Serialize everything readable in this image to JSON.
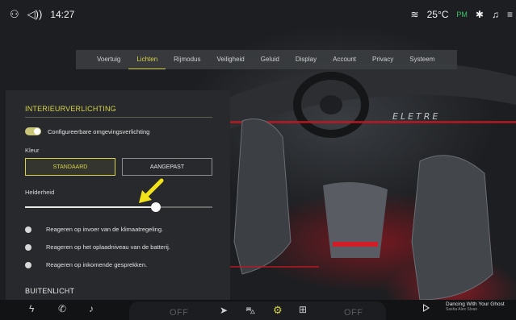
{
  "status": {
    "time": "14:27",
    "temperature": "25°C",
    "eco_label": "PM",
    "icons": [
      "user-icon",
      "volume-icon",
      "wifi-icon",
      "bluetooth-icon",
      "bell-icon",
      "settings-icon"
    ]
  },
  "nav": {
    "tabs": [
      {
        "label": "Voertuig"
      },
      {
        "label": "Lichten"
      },
      {
        "label": "Rijmodus"
      },
      {
        "label": "Veiligheid"
      },
      {
        "label": "Geluid"
      },
      {
        "label": "Display"
      },
      {
        "label": "Account"
      },
      {
        "label": "Privacy"
      },
      {
        "label": "Systeem"
      }
    ],
    "active": "Lichten"
  },
  "panel": {
    "title": "INTERIEURVERLICHTING",
    "toggle_label": "Configureerbare omgevingsverlichting",
    "toggle_on": true,
    "kleur_label": "Kleur",
    "buttons": {
      "standaard": "STANDAARD",
      "aangepast": "AANGEPAST"
    },
    "selected_color_mode": "STANDAARD",
    "helderheid_label": "Helderheid",
    "brightness_fraction": 0.7,
    "options": [
      "Reageren op invoer van de klimaatregeling.",
      "Reageren op het oplaadniveau van de batterij.",
      "Reageren op inkomende gesprekken."
    ],
    "next_section": "BUITENLICHT"
  },
  "brand_text": "ELETRE",
  "dock": {
    "left_temp": "OFF",
    "right_temp": "OFF",
    "media_title": "Dancing With Your Ghost",
    "media_artist": "Sasha Alex Sloan",
    "accent_color": "#d7d24a"
  }
}
